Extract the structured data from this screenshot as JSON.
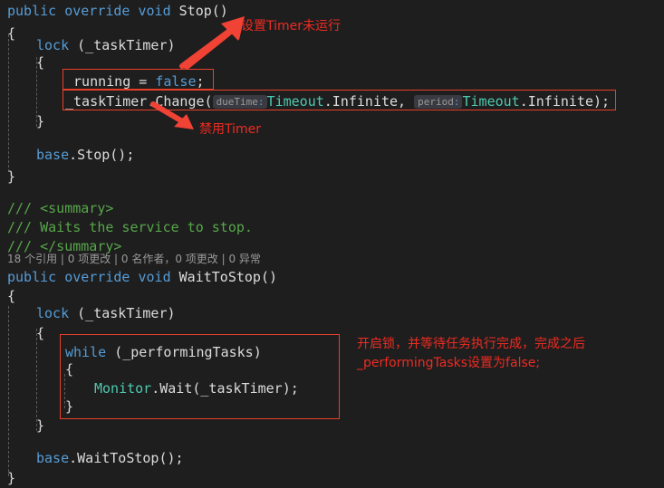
{
  "editor": {
    "background": "#1e1e1e",
    "default_text_color": "#d4d4d4",
    "keyword_color": "#569cd6",
    "type_color": "#4ec9b0",
    "comment_color": "#57a64a",
    "annotation_color": "#ee2b22"
  },
  "code": {
    "l1_keyword_public": "public",
    "l1_keyword_override": "override",
    "l1_keyword_void": "void",
    "l1_method": "Stop()",
    "l2_brace": "{",
    "l3_keyword_lock": "lock",
    "l3_arg": "(_taskTimer)",
    "l4_brace": "{",
    "l5_ident": "_running = ",
    "l5_false": "false",
    "l5_semi": ";",
    "l6_call": "_taskTimer.Change(",
    "l6_hint1": "dueTime",
    "l6_type1": "Timeout",
    "l6_member1": ".Infinite, ",
    "l6_hint2": "period",
    "l6_type2": "Timeout",
    "l6_member2": ".Infinite);",
    "l7_brace": "}",
    "l8_blank": "",
    "l9_base": "base",
    "l9_call": ".Stop();",
    "l10_brace": "}",
    "c1_summary_open": "/// <summary>",
    "c2_summary_text": "/// Waits the service to stop.",
    "c3_summary_close": "/// </summary>",
    "codelens": "18 个引用 | 0 项更改 | 0 名作者，0 项更改 | 0 异常",
    "m2_keyword_public": "public",
    "m2_keyword_override": "override",
    "m2_keyword_void": "void",
    "m2_method": "WaitToStop()",
    "m3_brace": "{",
    "m4_keyword_lock": "lock",
    "m4_arg": "(_taskTimer)",
    "m5_brace": "{",
    "m6_keyword_while": "while",
    "m6_cond": "(_performingTasks)",
    "m7_brace": "{",
    "m8_type": "Monitor",
    "m8_call": ".Wait(_taskTimer);",
    "m9_brace": "}",
    "m10_brace": "}",
    "m11_blank": "",
    "m12_base": "base",
    "m12_call": ".WaitToStop();",
    "m13_brace": "}"
  },
  "annotations": {
    "note1": "设置Timer未运行",
    "note2": "禁用Timer",
    "note3_line1": "开启锁，并等待任务执行完成，完成之后",
    "note3_line2": "_performingTasks设置为false;",
    "arrow1_name": "arrow-up-right",
    "arrow2_name": "arrow-down-right"
  }
}
